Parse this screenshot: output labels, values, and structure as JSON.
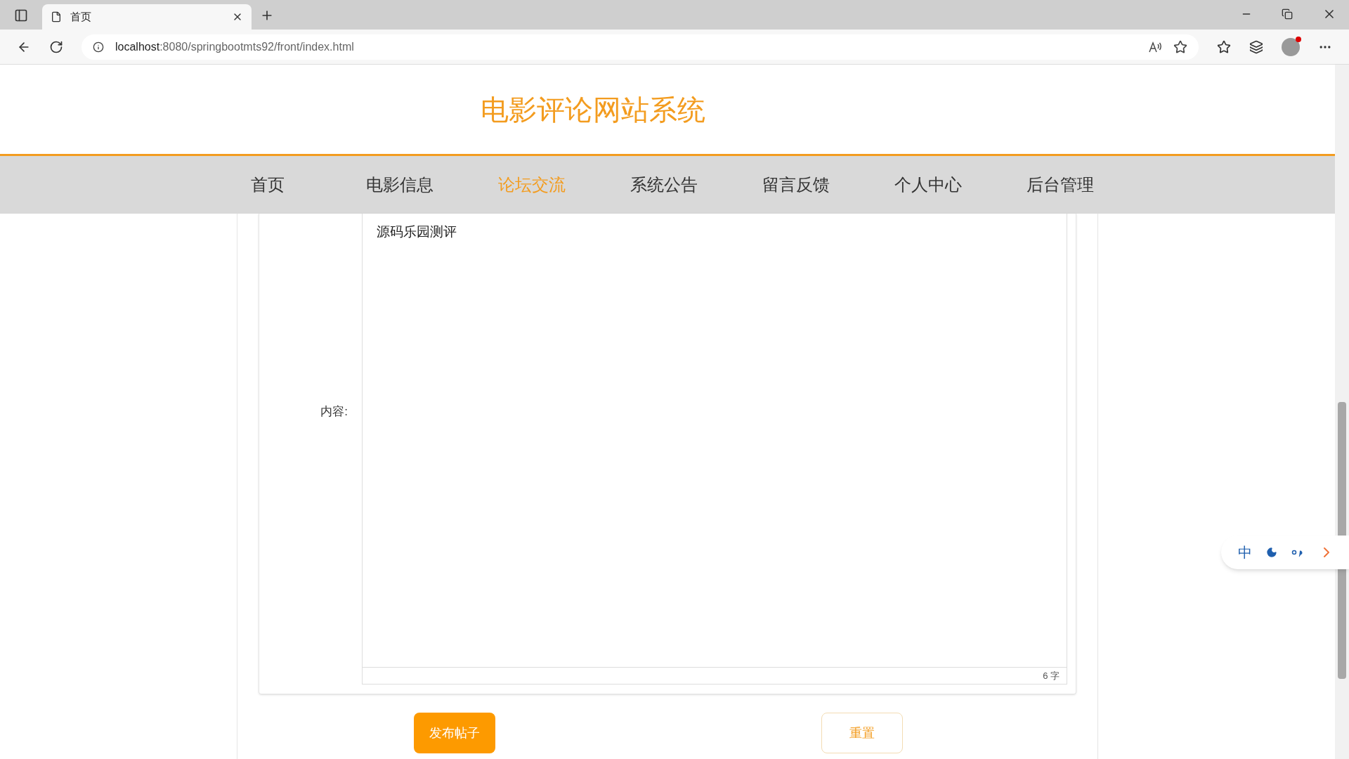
{
  "browser": {
    "tab_title": "首页",
    "url_host": "localhost",
    "url_rest": ":8080/springbootmts92/front/index.html"
  },
  "site_title": "电影评论网站系统",
  "nav": [
    {
      "label": "首页",
      "selected": false
    },
    {
      "label": "电影信息",
      "selected": false
    },
    {
      "label": "论坛交流",
      "selected": true
    },
    {
      "label": "系统公告",
      "selected": false
    },
    {
      "label": "留言反馈",
      "selected": false
    },
    {
      "label": "个人中心",
      "selected": false
    },
    {
      "label": "后台管理",
      "selected": false
    }
  ],
  "form": {
    "content_label": "内容:",
    "content_value": "源码乐园测评",
    "word_count": "6 字"
  },
  "buttons": [
    {
      "label": "发布帖子",
      "kind": "primary"
    },
    {
      "label": "重置",
      "kind": "secondary"
    }
  ],
  "ime": {
    "mode": "中"
  }
}
